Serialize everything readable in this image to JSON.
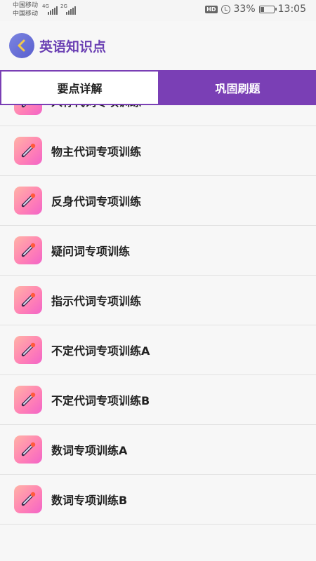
{
  "status_bar": {
    "carrier1": "中国移动",
    "carrier2": "中国移动",
    "net1": "4G",
    "net2": "2G",
    "hd": "HD",
    "battery_percent": "33%",
    "battery_level": 0.33,
    "time": "13:05"
  },
  "header": {
    "back_icon": "chevron-left-icon",
    "title": "英语知识点"
  },
  "tabs": [
    {
      "label": "要点详解",
      "active": true
    },
    {
      "label": "巩固刷题",
      "active": false
    }
  ],
  "list": {
    "item_icon": "pencil-icon",
    "items": [
      {
        "label": "人称代词专项训练"
      },
      {
        "label": "物主代词专项训练"
      },
      {
        "label": "反身代词专项训练"
      },
      {
        "label": "疑问词专项训练"
      },
      {
        "label": "指示代词专项训练"
      },
      {
        "label": "不定代词专项训练A"
      },
      {
        "label": "不定代词专项训练B"
      },
      {
        "label": "数词专项训练A"
      },
      {
        "label": "数词专项训练B"
      }
    ]
  },
  "colors": {
    "accent": "#7a3fb5",
    "title": "#6a3fb3",
    "icon_gradient": [
      "#ffb3a6",
      "#f264c8"
    ]
  }
}
